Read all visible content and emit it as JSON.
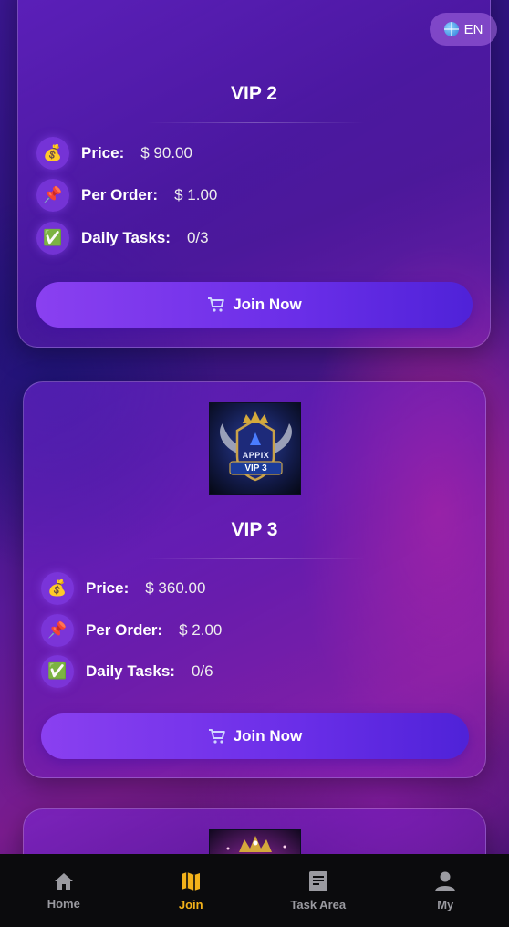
{
  "header": {
    "language": {
      "icon": "globe-icon",
      "label": "EN"
    }
  },
  "cards": [
    {
      "title": "VIP 2",
      "rows": [
        {
          "icon": "money-bag-icon",
          "label": "Price:",
          "value": "$ 90.00"
        },
        {
          "icon": "pushpin-icon",
          "label": "Per Order:",
          "value": "$ 1.00"
        },
        {
          "icon": "check-mark-icon",
          "label": "Daily Tasks:",
          "value": "0/3"
        }
      ],
      "button": {
        "icon": "cart-icon",
        "label": "Join Now"
      }
    },
    {
      "title": "VIP 3",
      "badge": {
        "brand": "APPIX",
        "level": "VIP 3"
      },
      "rows": [
        {
          "icon": "money-bag-icon",
          "label": "Price:",
          "value": "$ 360.00"
        },
        {
          "icon": "pushpin-icon",
          "label": "Per Order:",
          "value": "$ 2.00"
        },
        {
          "icon": "check-mark-icon",
          "label": "Daily Tasks:",
          "value": "0/6"
        }
      ],
      "button": {
        "icon": "cart-icon",
        "label": "Join Now"
      }
    }
  ],
  "bottom_nav": [
    {
      "icon": "home-icon",
      "label": "Home",
      "active": false
    },
    {
      "icon": "map-icon",
      "label": "Join",
      "active": true
    },
    {
      "icon": "document-icon",
      "label": "Task Area",
      "active": false
    },
    {
      "icon": "user-icon",
      "label": "My",
      "active": false
    }
  ],
  "colors": {
    "active_nav": "#f3b21a",
    "inactive_nav": "#9a9aa0",
    "button_gradient_start": "#8a40f0",
    "button_gradient_end": "#4f22d8"
  }
}
